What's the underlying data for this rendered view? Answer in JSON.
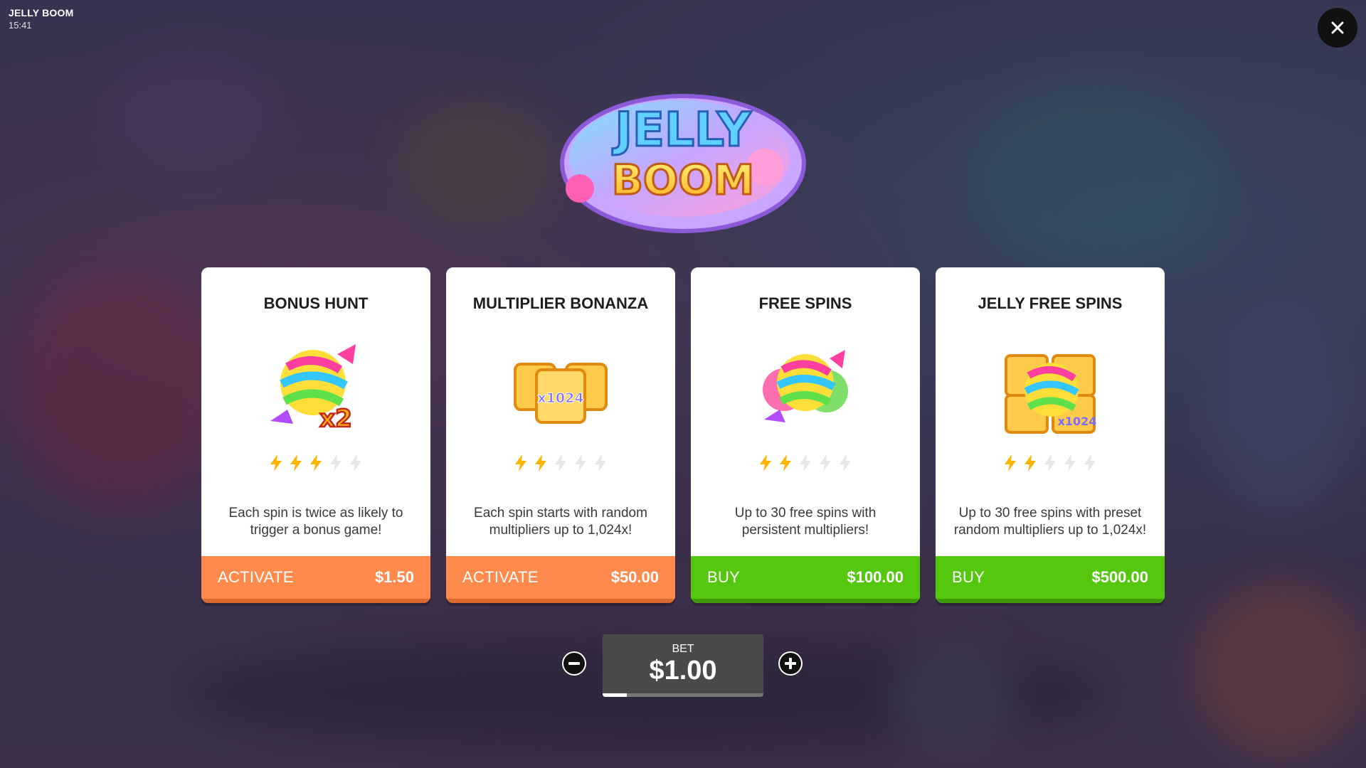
{
  "game": {
    "title": "JELLY BOOM",
    "time": "15:41"
  },
  "logo": {
    "line1": "JELLY",
    "line2": "BOOM"
  },
  "colors": {
    "orange": "#ff8a4c",
    "green": "#55c70f",
    "bolt_active": "#ffb400",
    "bolt_inactive": "#e6e6e6"
  },
  "cards": [
    {
      "title": "BONUS HUNT",
      "art": "striped-candy-x2-icon",
      "rating": 3,
      "rating_max": 5,
      "description": "Each spin is twice as likely to trigger a bonus game!",
      "action": "ACTIVATE",
      "price": "$1.50",
      "style": "orange"
    },
    {
      "title": "MULTIPLIER BONANZA",
      "art": "multiplier-tiles-icon",
      "rating": 2,
      "rating_max": 5,
      "description": "Each spin starts with random multipliers up to 1,024x!",
      "action": "ACTIVATE",
      "price": "$50.00",
      "style": "orange"
    },
    {
      "title": "FREE SPINS",
      "art": "candy-cluster-icon",
      "rating": 2,
      "rating_max": 5,
      "description": "Up to 30 free spins with persistent multipliers!",
      "action": "BUY",
      "price": "$100.00",
      "style": "green"
    },
    {
      "title": "JELLY FREE SPINS",
      "art": "candy-on-tiles-icon",
      "rating": 2,
      "rating_max": 5,
      "description": "Up to 30 free spins with preset random multipliers up to 1,024x!",
      "action": "BUY",
      "price": "$500.00",
      "style": "green"
    }
  ],
  "art_labels": {
    "card0": "x2",
    "card1": "x1024",
    "card3": "x1024"
  },
  "bet": {
    "label": "BET",
    "value": "$1.00",
    "level": 0.15
  }
}
